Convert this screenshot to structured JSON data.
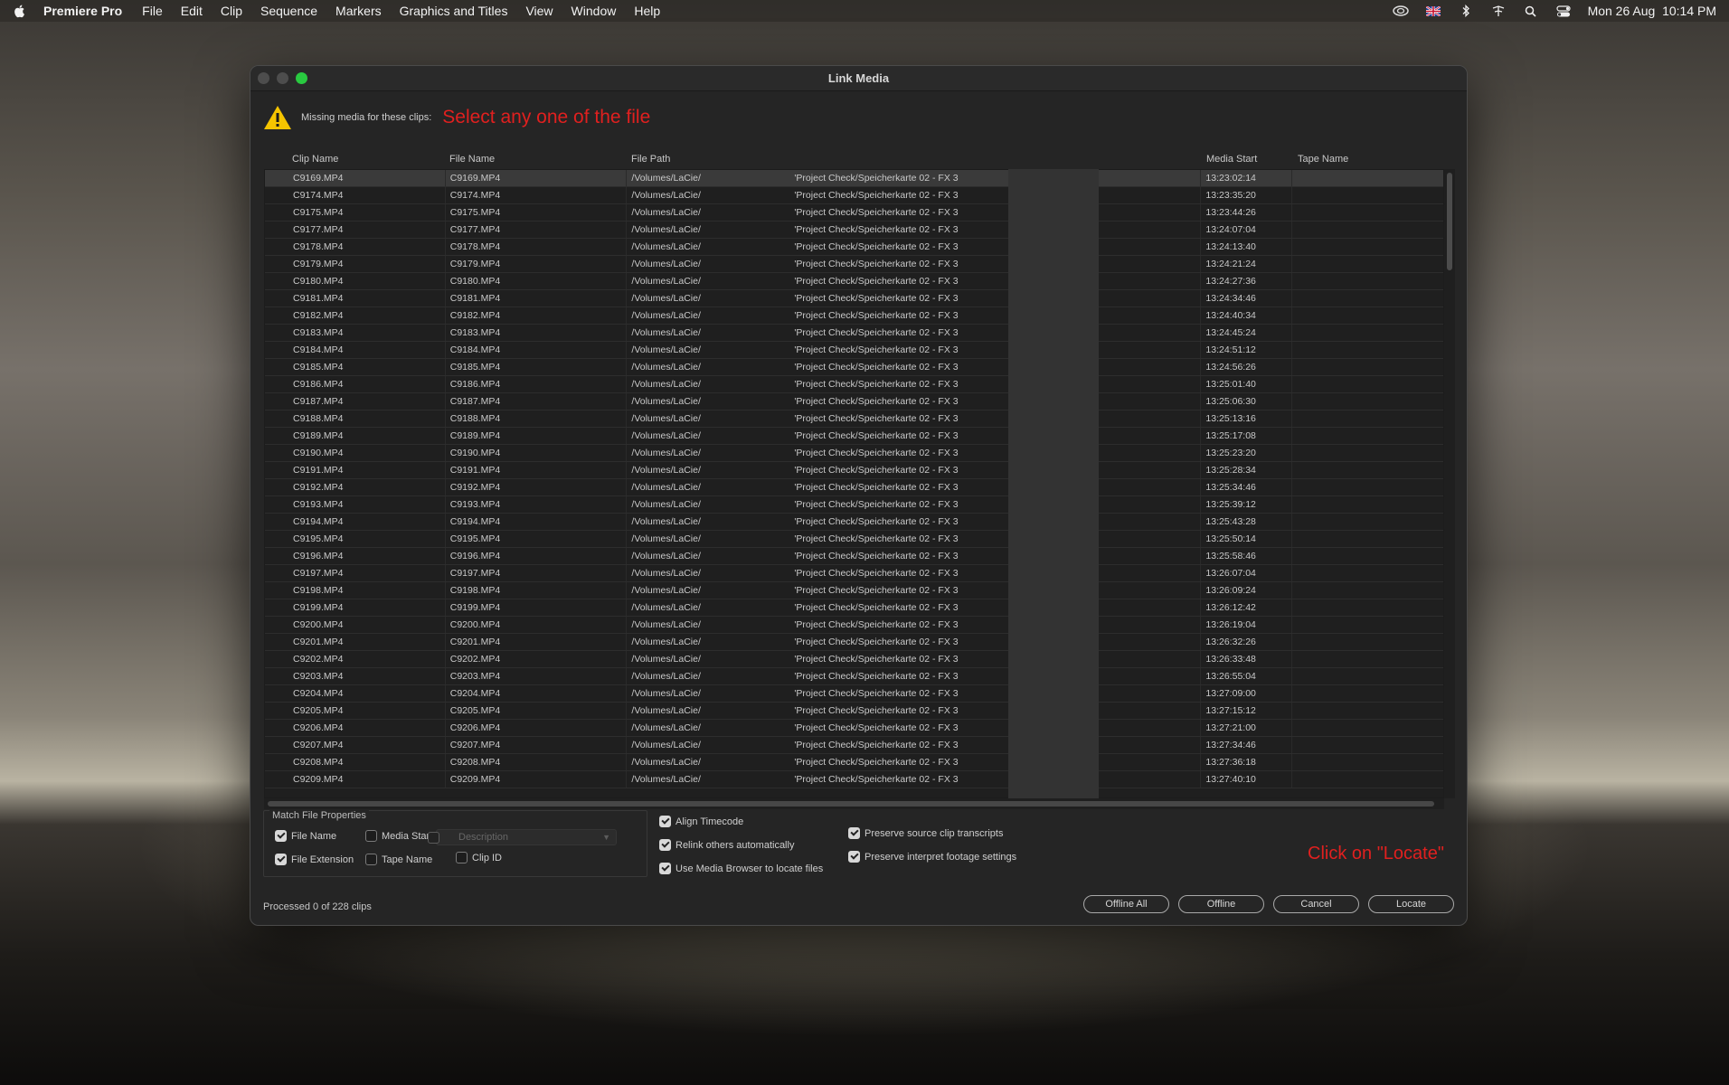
{
  "menubar": {
    "app": "Premiere Pro",
    "items": [
      "File",
      "Edit",
      "Clip",
      "Sequence",
      "Markers",
      "Graphics and Titles",
      "View",
      "Window",
      "Help"
    ],
    "clock": "Mon 26 Aug  10:14 PM",
    "status_icons": [
      "creative-cloud-icon",
      "uk-flag-icon",
      "bluetooth-icon",
      "network-icon",
      "search-icon",
      "control-center-icon"
    ]
  },
  "dialog": {
    "title": "Link Media",
    "missing_label": "Missing media for these clips:",
    "annotation_top": "Select any one of the file",
    "annotation_bottom": "Click on \"Locate\"",
    "columns": [
      "Clip Name",
      "File Name",
      "File Path",
      "Media Start",
      "Tape Name"
    ],
    "path_prefix": "/Volumes/LaCie/",
    "path_suffix": "'Project Check/Speicherkarte 02 - FX 3",
    "rows": [
      {
        "clip": "C9169.MP4",
        "file": "C9169.MP4",
        "start": "13:23:02:14"
      },
      {
        "clip": "C9174.MP4",
        "file": "C9174.MP4",
        "start": "13:23:35:20"
      },
      {
        "clip": "C9175.MP4",
        "file": "C9175.MP4",
        "start": "13:23:44:26"
      },
      {
        "clip": "C9177.MP4",
        "file": "C9177.MP4",
        "start": "13:24:07:04"
      },
      {
        "clip": "C9178.MP4",
        "file": "C9178.MP4",
        "start": "13:24:13:40"
      },
      {
        "clip": "C9179.MP4",
        "file": "C9179.MP4",
        "start": "13:24:21:24"
      },
      {
        "clip": "C9180.MP4",
        "file": "C9180.MP4",
        "start": "13:24:27:36"
      },
      {
        "clip": "C9181.MP4",
        "file": "C9181.MP4",
        "start": "13:24:34:46"
      },
      {
        "clip": "C9182.MP4",
        "file": "C9182.MP4",
        "start": "13:24:40:34"
      },
      {
        "clip": "C9183.MP4",
        "file": "C9183.MP4",
        "start": "13:24:45:24"
      },
      {
        "clip": "C9184.MP4",
        "file": "C9184.MP4",
        "start": "13:24:51:12"
      },
      {
        "clip": "C9185.MP4",
        "file": "C9185.MP4",
        "start": "13:24:56:26"
      },
      {
        "clip": "C9186.MP4",
        "file": "C9186.MP4",
        "start": "13:25:01:40"
      },
      {
        "clip": "C9187.MP4",
        "file": "C9187.MP4",
        "start": "13:25:06:30"
      },
      {
        "clip": "C9188.MP4",
        "file": "C9188.MP4",
        "start": "13:25:13:16"
      },
      {
        "clip": "C9189.MP4",
        "file": "C9189.MP4",
        "start": "13:25:17:08"
      },
      {
        "clip": "C9190.MP4",
        "file": "C9190.MP4",
        "start": "13:25:23:20"
      },
      {
        "clip": "C9191.MP4",
        "file": "C9191.MP4",
        "start": "13:25:28:34"
      },
      {
        "clip": "C9192.MP4",
        "file": "C9192.MP4",
        "start": "13:25:34:46"
      },
      {
        "clip": "C9193.MP4",
        "file": "C9193.MP4",
        "start": "13:25:39:12"
      },
      {
        "clip": "C9194.MP4",
        "file": "C9194.MP4",
        "start": "13:25:43:28"
      },
      {
        "clip": "C9195.MP4",
        "file": "C9195.MP4",
        "start": "13:25:50:14"
      },
      {
        "clip": "C9196.MP4",
        "file": "C9196.MP4",
        "start": "13:25:58:46"
      },
      {
        "clip": "C9197.MP4",
        "file": "C9197.MP4",
        "start": "13:26:07:04"
      },
      {
        "clip": "C9198.MP4",
        "file": "C9198.MP4",
        "start": "13:26:09:24"
      },
      {
        "clip": "C9199.MP4",
        "file": "C9199.MP4",
        "start": "13:26:12:42"
      },
      {
        "clip": "C9200.MP4",
        "file": "C9200.MP4",
        "start": "13:26:19:04"
      },
      {
        "clip": "C9201.MP4",
        "file": "C9201.MP4",
        "start": "13:26:32:26"
      },
      {
        "clip": "C9202.MP4",
        "file": "C9202.MP4",
        "start": "13:26:33:48"
      },
      {
        "clip": "C9203.MP4",
        "file": "C9203.MP4",
        "start": "13:26:55:04"
      },
      {
        "clip": "C9204.MP4",
        "file": "C9204.MP4",
        "start": "13:27:09:00"
      },
      {
        "clip": "C9205.MP4",
        "file": "C9205.MP4",
        "start": "13:27:15:12"
      },
      {
        "clip": "C9206.MP4",
        "file": "C9206.MP4",
        "start": "13:27:21:00"
      },
      {
        "clip": "C9207.MP4",
        "file": "C9207.MP4",
        "start": "13:27:34:46"
      },
      {
        "clip": "C9208.MP4",
        "file": "C9208.MP4",
        "start": "13:27:36:18"
      },
      {
        "clip": "C9209.MP4",
        "file": "C9209.MP4",
        "start": "13:27:40:10"
      }
    ],
    "match": {
      "legend": "Match File Properties",
      "file_name": "File Name",
      "media_start": "Media Start",
      "description": "Description",
      "file_extension": "File Extension",
      "tape_name": "Tape Name",
      "clip_id": "Clip ID"
    },
    "options": {
      "align_timecode": "Align Timecode",
      "relink_others": "Relink others automatically",
      "use_media_browser": "Use Media Browser to locate files",
      "preserve_transcripts": "Preserve source clip transcripts",
      "preserve_interpret": "Preserve interpret footage settings"
    },
    "processed": "Processed 0 of 228 clips",
    "buttons": {
      "offline_all": "Offline All",
      "offline": "Offline",
      "cancel": "Cancel",
      "locate": "Locate"
    },
    "colors": {
      "annotation": "#e0201f",
      "dialog_bg": "#252525",
      "traffic_green": "#29c940",
      "warning_yellow": "#f5c400"
    }
  }
}
